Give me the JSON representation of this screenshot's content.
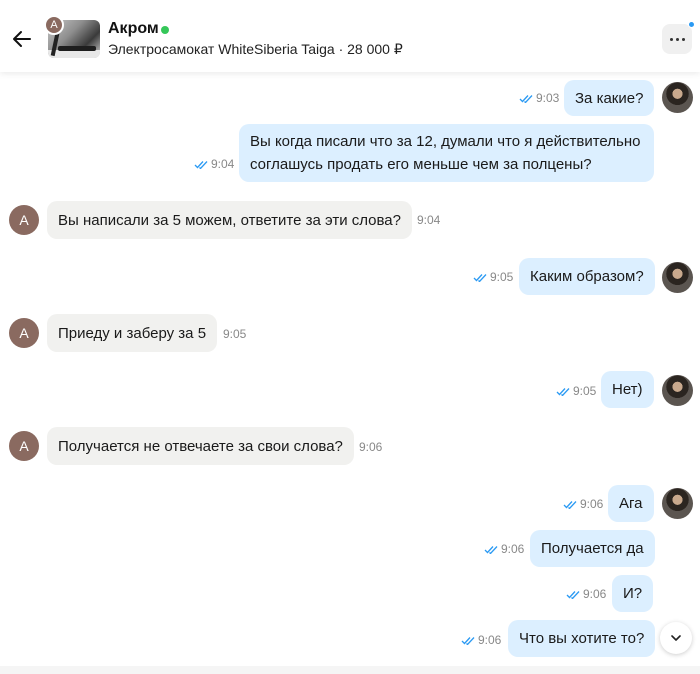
{
  "header": {
    "contact_name": "Акром",
    "contact_initial": "А",
    "listing_title": "Электросамокат WhiteSiberia Taiga · 28 000 ₽",
    "online_color": "#35c759",
    "back_icon": "arrow-left-icon",
    "menu_icon": "more-horizontal-icon"
  },
  "messages": [
    {
      "dir": "out",
      "text": "За какие?",
      "time": "9:03",
      "status": "read"
    },
    {
      "dir": "out",
      "text": "Вы когда писали что за 12, думали что я действительно соглашусь продать его меньше чем за полцены?",
      "time": "9:04",
      "status": "read"
    },
    {
      "dir": "in",
      "text": "Вы написали за 5 можем, ответите за эти слова?",
      "time": "9:04",
      "initial": "А"
    },
    {
      "dir": "out",
      "text": "Каким образом?",
      "time": "9:05",
      "status": "read"
    },
    {
      "dir": "in",
      "text": "Приеду и заберу за 5",
      "time": "9:05",
      "initial": "А"
    },
    {
      "dir": "out",
      "text": "Нет)",
      "time": "9:05",
      "status": "read"
    },
    {
      "dir": "in",
      "text": "Получается не отвечаете за свои слова?",
      "time": "9:06",
      "initial": "А"
    },
    {
      "dir": "out",
      "text": "Ага",
      "time": "9:06",
      "status": "read"
    },
    {
      "dir": "out",
      "text": "Получается да",
      "time": "9:06",
      "status": "read"
    },
    {
      "dir": "out",
      "text": "И?",
      "time": "9:06",
      "status": "read"
    },
    {
      "dir": "out",
      "text": "Что вы хотите то?",
      "time": "9:06",
      "status": "read"
    }
  ],
  "colors": {
    "outgoing_bubble": "#dcefff",
    "incoming_bubble": "#f1f1ef",
    "check_read": "#2b9af3",
    "avatar_bg": "#8a6a60"
  }
}
